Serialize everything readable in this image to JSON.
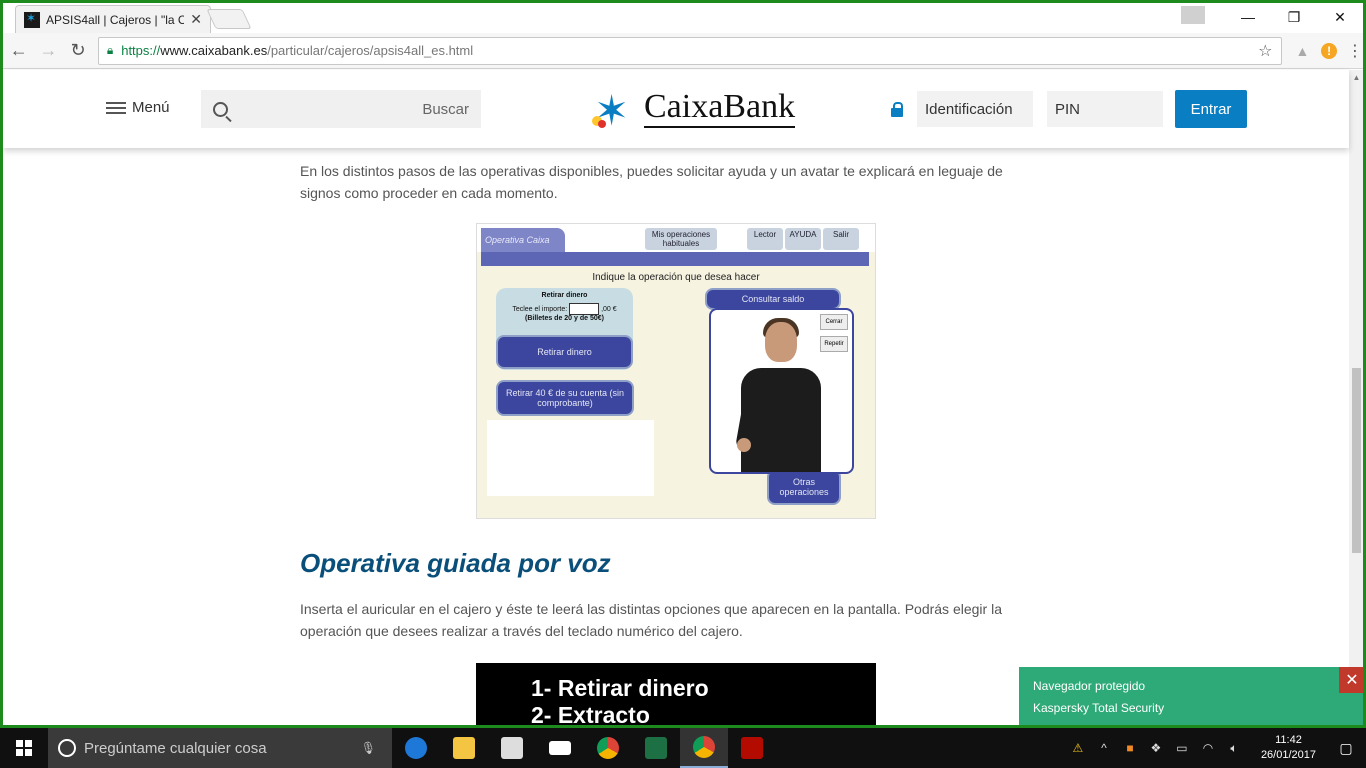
{
  "browser": {
    "tab_title": "APSIS4all | Cajeros | \"la C",
    "tab_close": "✕",
    "url_proto": "https://",
    "url_host": "www.caixabank.es",
    "url_path": "/particular/cajeros/apsis4all_es.html",
    "window_controls": {
      "minimize": "—",
      "restore": "❐",
      "close": "✕"
    }
  },
  "header": {
    "menu_label": "Menú",
    "search_label": "Buscar",
    "logo_text": "CaixaBank",
    "ident_placeholder": "Identificación",
    "pin_placeholder": "PIN",
    "enter_label": "Entrar"
  },
  "content": {
    "para1": "En los distintos pasos de las operativas disponibles, puedes solicitar ayuda y un avatar te explicará en leguaje de signos como proceder en cada momento.",
    "heading": "Operativa guiada por voz",
    "para2": "Inserta el auricular en el cajero y éste te leerá las distintas opciones que aparecen en la pantalla. Podrás elegir la operación que desees realizar a través del teclado numérico del cajero."
  },
  "atm_image": {
    "tab": "Operativa Caixa",
    "btn_mis": "Mis operaciones habituales",
    "btn_lector": "Lector",
    "btn_ayuda": "AYUDA",
    "btn_salir": "Salir",
    "title": "Indique la operación que desea hacer",
    "retirar_title": "Retirar dinero",
    "teclee": "Teclee el importe:",
    "importe_suffix": ",00 €",
    "billetes": "(Billetes de 20 y de 50€)",
    "retirar_btn": "Retirar dinero",
    "retirar40": "Retirar 40 € de su cuenta (sin comprobante)",
    "consultar": "Consultar saldo",
    "otras": "Otras operaciones",
    "cerrar": "Cerrar",
    "repetir": "Repetir"
  },
  "image2": {
    "line1": "1- Retirar dinero",
    "line2": "2- Extracto"
  },
  "notification": {
    "line1": "Navegador protegido",
    "line2": "Kaspersky Total Security",
    "close": "✕"
  },
  "taskbar": {
    "search_placeholder": "Pregúntame cualquier cosa",
    "time": "11:42",
    "date": "26/01/2017"
  },
  "colors": {
    "brand_blue": "#0a7ec2",
    "heading_blue": "#0a4f7a",
    "kaspersky_green": "#2eaa78"
  }
}
